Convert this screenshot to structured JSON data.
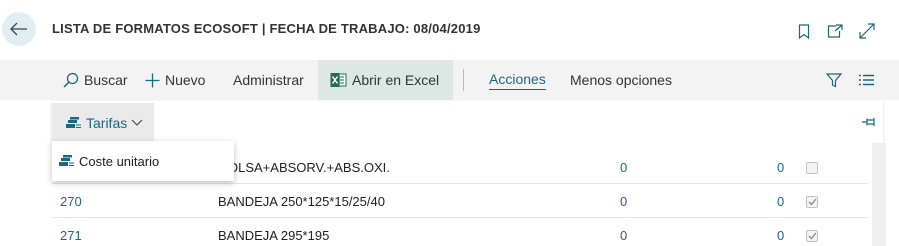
{
  "header": {
    "title": "LISTA DE FORMATOS ECOSOFT | FECHA DE TRABAJO: 08/04/2019",
    "icons": [
      "back-arrow-icon",
      "bookmark-icon",
      "open-new-window-icon",
      "expand-icon"
    ]
  },
  "actionbar": {
    "buscar": "Buscar",
    "nuevo": "Nuevo",
    "administrar": "Administrar",
    "excel": "Abrir en Excel",
    "acciones": "Acciones",
    "menos": "Menos opciones"
  },
  "subbar": {
    "tarifas": "Tarifas"
  },
  "dropdown": {
    "item": "Coste unitario"
  },
  "table": {
    "rows": [
      {
        "code": "",
        "description": "OLSA+ABSORV.+ABS.OXI.",
        "qty1": "0",
        "qty2": "0",
        "checked": false
      },
      {
        "code": "270",
        "description": "BANDEJA 250*125*15/25/40",
        "qty1": "0",
        "qty2": "0",
        "checked": true
      },
      {
        "code": "271",
        "description": "BANDEJA 295*195",
        "qty1": "0",
        "qty2": "0",
        "checked": true
      }
    ]
  },
  "colors": {
    "accent": "#1a6880",
    "actionbar_bg": "#f3f3f3",
    "excel_bg": "#dde8e4",
    "excel_green": "#1e7145"
  }
}
